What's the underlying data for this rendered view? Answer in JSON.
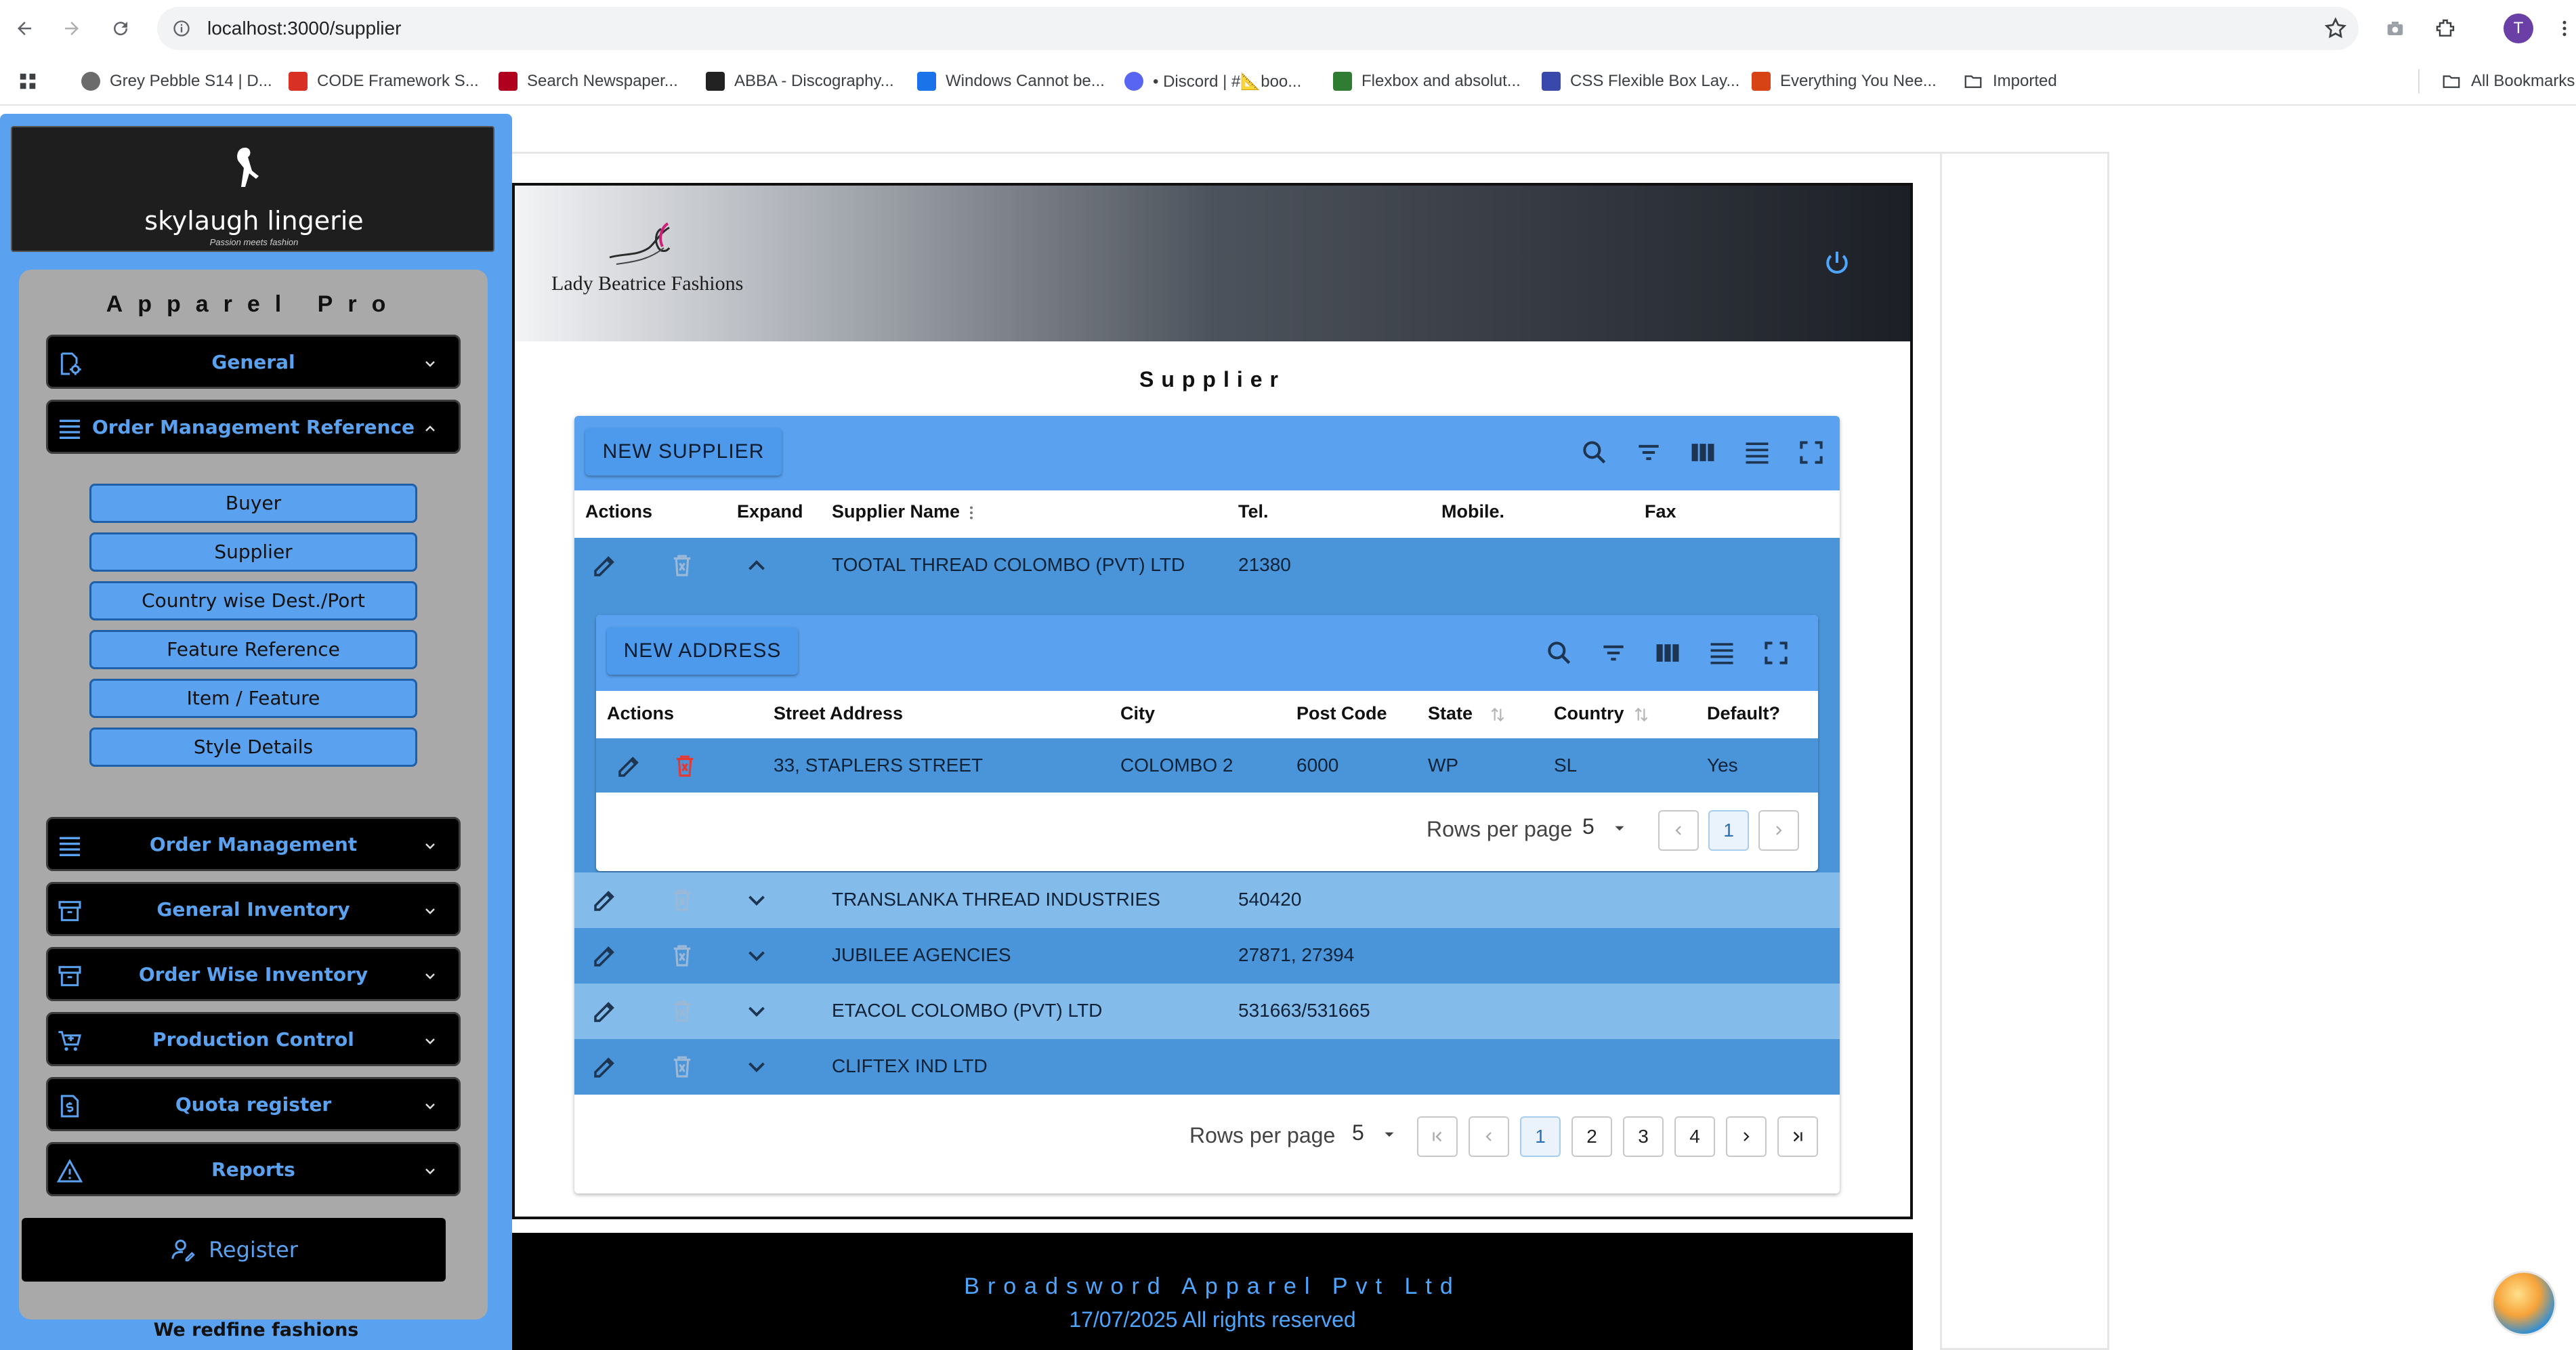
{
  "browser": {
    "url": "localhost:3000/supplier",
    "avatar_letter": "T",
    "bookmarks": [
      {
        "label": "Grey Pebble S14 | D...",
        "color": "#6b6b6b"
      },
      {
        "label": "CODE Framework S...",
        "color": "#d93025"
      },
      {
        "label": "Search Newspaper...",
        "color": "#b00020"
      },
      {
        "label": "ABBA - Discography...",
        "color": "#222222"
      },
      {
        "label": "Windows Cannot be...",
        "color": "#1a73e8"
      },
      {
        "label": "• Discord | #📐boo...",
        "color": "#5865f2"
      },
      {
        "label": "Flexbox and absolut...",
        "color": "#2e7d32"
      },
      {
        "label": "CSS Flexible Box Lay...",
        "color": "#3949ab"
      },
      {
        "label": "Everything You Nee...",
        "color": "#d84315"
      },
      {
        "label": "Imported",
        "color": "#5f6368"
      }
    ],
    "all_bookmarks": "All Bookmarks"
  },
  "sidebar": {
    "brand": "skylaugh lingerie",
    "brand_tag": "Passion meets fashion",
    "app_title": "Apparel Pro",
    "menu": [
      {
        "label": "General",
        "icon": "settings-doc-icon",
        "expanded": false
      },
      {
        "label": "Order Management Reference",
        "icon": "list-icon",
        "expanded": true
      },
      {
        "label": "Order Management",
        "icon": "list-icon",
        "expanded": false
      },
      {
        "label": "General Inventory",
        "icon": "archive-icon",
        "expanded": false
      },
      {
        "label": "Order Wise Inventory",
        "icon": "archive-icon",
        "expanded": false
      },
      {
        "label": "Production Control",
        "icon": "cart-icon",
        "expanded": false
      },
      {
        "label": "Quota register",
        "icon": "dollar-doc-icon",
        "expanded": false
      },
      {
        "label": "Reports",
        "icon": "warning-icon",
        "expanded": false
      }
    ],
    "submenu": [
      "Buyer",
      "Supplier",
      "Country wise Dest./Port",
      "Feature Reference",
      "Item / Feature",
      "Style Details"
    ],
    "register": "Register",
    "footer": "We redfine fashions"
  },
  "header": {
    "company_logo_text": "Lady Beatrice Fashions"
  },
  "page": {
    "title": "Supplier"
  },
  "supplier_table": {
    "new_button": "NEW SUPPLIER",
    "columns": [
      "Actions",
      "Expand",
      "Supplier Name",
      "Tel.",
      "Mobile.",
      "Fax"
    ],
    "rows": [
      {
        "name": "TOOTAL THREAD COLOMBO (PVT) LTD",
        "tel": "21380",
        "mobile": "",
        "fax": "",
        "expanded": true
      },
      {
        "name": "TRANSLANKA THREAD INDUSTRIES",
        "tel": "540420",
        "mobile": "",
        "fax": "",
        "expanded": false
      },
      {
        "name": "JUBILEE AGENCIES",
        "tel": "27871, 27394",
        "mobile": "",
        "fax": "",
        "expanded": false
      },
      {
        "name": "ETACOL COLOMBO (PVT) LTD",
        "tel": "531663/531665",
        "mobile": "",
        "fax": "",
        "expanded": false
      },
      {
        "name": "CLIFTEX IND LTD",
        "tel": "",
        "mobile": "",
        "fax": "",
        "expanded": false
      }
    ],
    "rows_per_page_label": "Rows per page",
    "rows_per_page": "5",
    "pages": [
      "1",
      "2",
      "3",
      "4"
    ],
    "current_page": "1"
  },
  "address_table": {
    "new_button": "NEW ADDRESS",
    "columns": [
      "Actions",
      "Street Address",
      "City",
      "Post Code",
      "State",
      "Country",
      "Default?"
    ],
    "rows": [
      {
        "street": "33, STAPLERS STREET",
        "city": "COLOMBO 2",
        "post_code": "6000",
        "state": "WP",
        "country": "SL",
        "default": "Yes"
      }
    ],
    "rows_per_page_label": "Rows per page",
    "rows_per_page": "5",
    "current_page": "1"
  },
  "footer": {
    "company": "Broadsword Apparel Pvt Ltd",
    "copyright": "17/07/2025 All rights reserved"
  },
  "colors": {
    "accent": "#5aa2f0",
    "row_dark": "#4a95d9",
    "row_light": "#83bbeb",
    "delete_red": "#e53935"
  }
}
